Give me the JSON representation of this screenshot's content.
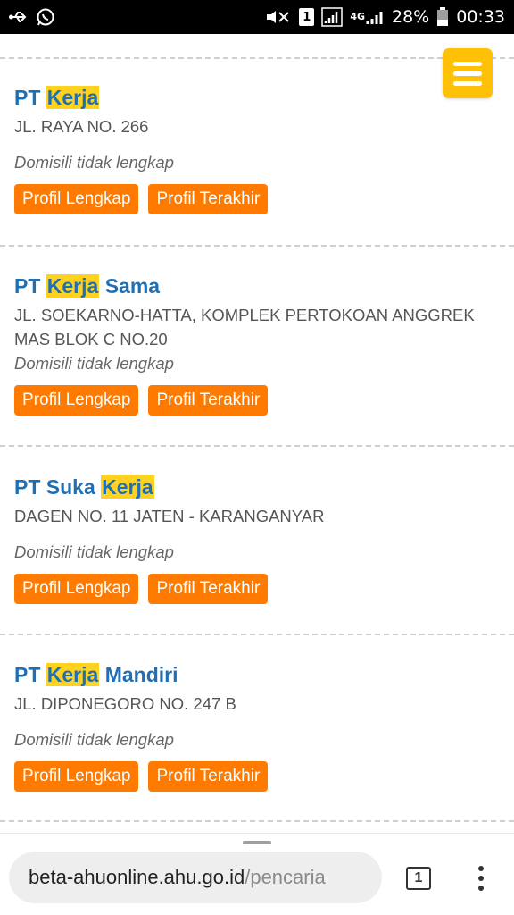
{
  "status_bar": {
    "battery": "28%",
    "time": "00:33",
    "sim_slot": "1",
    "network": "4G",
    "icons": [
      "usb-icon",
      "whatsapp-icon",
      "mute-icon",
      "sim-icon",
      "signal-icon",
      "battery-icon"
    ]
  },
  "results": [
    {
      "name_prefix": "PT ",
      "name_highlight": "Kerja",
      "name_suffix": "",
      "address": "JL. RAYA NO. 266",
      "domisili": "Domisili tidak lengkap",
      "btn_profil_lengkap": "Profil Lengkap",
      "btn_profil_terakhir": "Profil Terakhir"
    },
    {
      "name_prefix": "PT ",
      "name_highlight": "Kerja",
      "name_suffix": " Sama",
      "address": "JL. SOEKARNO-HATTA, KOMPLEK PERTOKOAN ANGGREK MAS BLOK C NO.20",
      "domisili": "Domisili tidak lengkap",
      "btn_profil_lengkap": "Profil Lengkap",
      "btn_profil_terakhir": "Profil Terakhir"
    },
    {
      "name_prefix": "PT Suka ",
      "name_highlight": "Kerja",
      "name_suffix": "",
      "address": "DAGEN NO. 11 JATEN - KARANGANYAR",
      "domisili": "Domisili tidak lengkap",
      "btn_profil_lengkap": "Profil Lengkap",
      "btn_profil_terakhir": "Profil Terakhir"
    },
    {
      "name_prefix": "PT ",
      "name_highlight": "Kerja",
      "name_suffix": " Mandiri",
      "address": "JL. DIPONEGORO NO. 247 B",
      "domisili": "Domisili tidak lengkap",
      "btn_profil_lengkap": "Profil Lengkap",
      "btn_profil_terakhir": "Profil Terakhir"
    }
  ],
  "browser": {
    "url_domain": "beta-ahuonline.ahu.go.id",
    "url_path": "/pencaria",
    "tab_count": "1"
  },
  "colors": {
    "accent_button": "#ff7a00",
    "name_color": "#1f6fb4",
    "highlight": "#ffd21f",
    "menu_button": "#ffc107"
  }
}
